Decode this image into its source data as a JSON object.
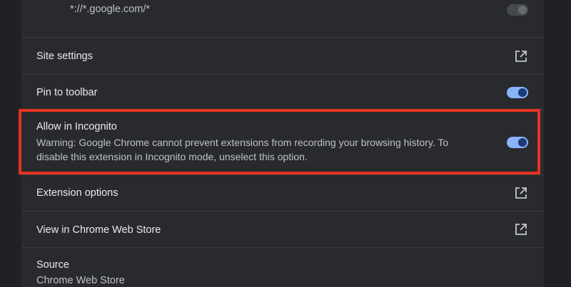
{
  "host_permission": {
    "pattern": "*://*.google.com/*",
    "enabled": false
  },
  "rows": {
    "site_settings": {
      "label": "Site settings",
      "icon": "open-in-new-icon"
    },
    "pin_to_toolbar": {
      "label": "Pin to toolbar",
      "enabled": true
    },
    "allow_incognito": {
      "label": "Allow in Incognito",
      "warning": "Warning: Google Chrome cannot prevent extensions from recording your browsing history. To disable this extension in Incognito mode, unselect this option.",
      "enabled": true
    },
    "extension_options": {
      "label": "Extension options",
      "icon": "open-in-new-icon"
    },
    "web_store": {
      "label": "View in Chrome Web Store",
      "icon": "open-in-new-icon"
    },
    "source": {
      "label": "Source",
      "value": "Chrome Web Store"
    }
  },
  "colors": {
    "background": "#202124",
    "panel": "#292a2d",
    "toggle_on": "#8ab4f8",
    "highlight_border": "#e63323"
  }
}
